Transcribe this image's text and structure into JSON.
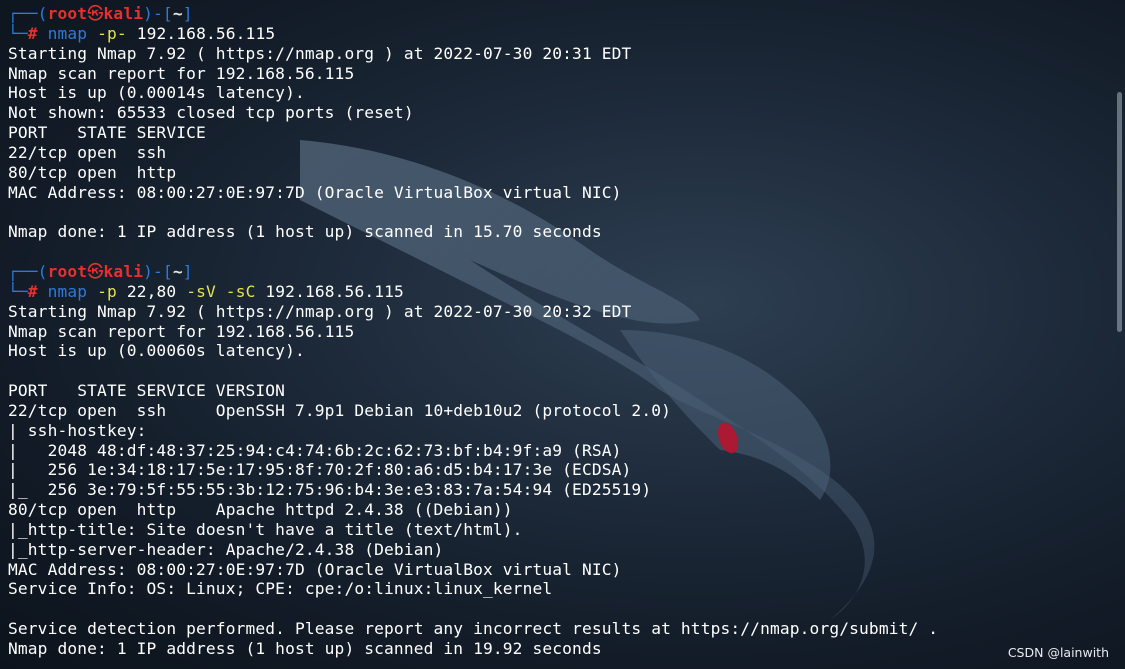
{
  "prompt": {
    "user": "root",
    "skull": "㉿",
    "host": "kali",
    "dir": "~",
    "symbol": "#"
  },
  "session1": {
    "command": "nmap",
    "flag1": "-p-",
    "arg1": "192.168.56.115",
    "output": [
      "Starting Nmap 7.92 ( https://nmap.org ) at 2022-07-30 20:31 EDT",
      "Nmap scan report for 192.168.56.115",
      "Host is up (0.00014s latency).",
      "Not shown: 65533 closed tcp ports (reset)",
      "PORT   STATE SERVICE",
      "22/tcp open  ssh",
      "80/tcp open  http",
      "MAC Address: 08:00:27:0E:97:7D (Oracle VirtualBox virtual NIC)",
      "",
      "Nmap done: 1 IP address (1 host up) scanned in 15.70 seconds",
      ""
    ]
  },
  "session2": {
    "command": "nmap",
    "flag1": "-p",
    "arg1": "22,80",
    "flag2": "-sV",
    "flag3": "-sC",
    "arg2": "192.168.56.115",
    "output": [
      "Starting Nmap 7.92 ( https://nmap.org ) at 2022-07-30 20:32 EDT",
      "Nmap scan report for 192.168.56.115",
      "Host is up (0.00060s latency).",
      "",
      "PORT   STATE SERVICE VERSION",
      "22/tcp open  ssh     OpenSSH 7.9p1 Debian 10+deb10u2 (protocol 2.0)",
      "| ssh-hostkey: ",
      "|   2048 48:df:48:37:25:94:c4:74:6b:2c:62:73:bf:b4:9f:a9 (RSA)",
      "|   256 1e:34:18:17:5e:17:95:8f:70:2f:80:a6:d5:b4:17:3e (ECDSA)",
      "|_  256 3e:79:5f:55:55:3b:12:75:96:b4:3e:e3:83:7a:54:94 (ED25519)",
      "80/tcp open  http    Apache httpd 2.4.38 ((Debian))",
      "|_http-title: Site doesn't have a title (text/html).",
      "|_http-server-header: Apache/2.4.38 (Debian)",
      "MAC Address: 08:00:27:0E:97:7D (Oracle VirtualBox virtual NIC)",
      "Service Info: OS: Linux; CPE: cpe:/o:linux:linux_kernel",
      "",
      "Service detection performed. Please report any incorrect results at https://nmap.org/submit/ .",
      "Nmap done: 1 IP address (1 host up) scanned in 19.92 seconds"
    ]
  },
  "watermark": "CSDN @lainwith",
  "colors": {
    "prompt_blue": "#2f7ad9",
    "prompt_red": "#e8302e",
    "flag_yellow": "#e3e34a",
    "output_white": "#ffffff"
  }
}
